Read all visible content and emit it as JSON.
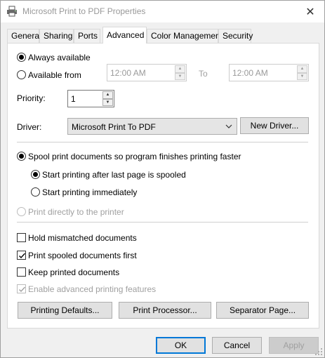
{
  "window": {
    "title": "Microsoft Print to PDF Properties",
    "close": "✕"
  },
  "tabs": [
    {
      "label": "General"
    },
    {
      "label": "Sharing"
    },
    {
      "label": "Ports"
    },
    {
      "label": "Advanced",
      "active": true
    },
    {
      "label": "Color Management"
    },
    {
      "label": "Security"
    }
  ],
  "availability": {
    "always_label": "Always available",
    "from_label": "Available from",
    "from_time": "12:00 AM",
    "to_label": "To",
    "to_time": "12:00 AM",
    "selected": "always"
  },
  "priority": {
    "label": "Priority:",
    "value": "1"
  },
  "driver": {
    "label": "Driver:",
    "value": "Microsoft Print To PDF",
    "new_driver_button": "New Driver..."
  },
  "spooling": {
    "spool_label": "Spool print documents so program finishes printing faster",
    "after_last_page_label": "Start printing after last page is spooled",
    "immediately_label": "Start printing immediately",
    "direct_label": "Print directly to the printer",
    "selected": "spool",
    "sub_selected": "after_last_page"
  },
  "options": {
    "hold_mismatched": {
      "label": "Hold mismatched documents",
      "checked": false
    },
    "spooled_first": {
      "label": "Print spooled documents first",
      "checked": true
    },
    "keep_printed": {
      "label": "Keep printed documents",
      "checked": false
    },
    "advanced_features": {
      "label": "Enable advanced printing features",
      "checked": true,
      "disabled": true
    }
  },
  "panel_buttons": {
    "defaults": "Printing Defaults...",
    "processor": "Print Processor...",
    "separator": "Separator Page..."
  },
  "dialog_buttons": {
    "ok": "OK",
    "cancel": "Cancel",
    "apply": "Apply"
  }
}
